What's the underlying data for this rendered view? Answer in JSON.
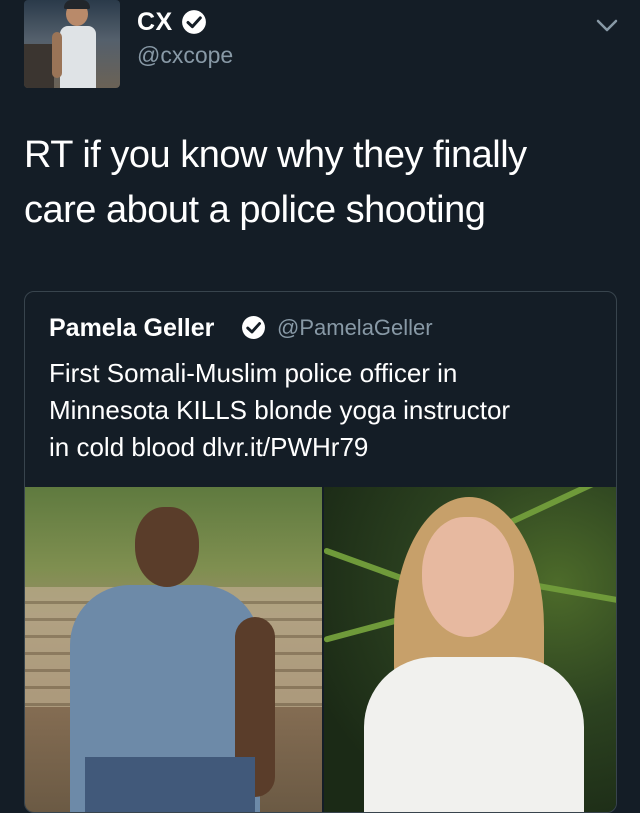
{
  "tweet": {
    "author": {
      "name": "CX",
      "handle": "@cxcope",
      "verified": true
    },
    "text": "RT if you know why they finally\ncare about a police shooting",
    "menu_icon": "chevron-down-icon"
  },
  "quoted_tweet": {
    "author": {
      "name": "Pamela Geller",
      "handle": "@PamelaGeller",
      "verified": true
    },
    "text": "First Somali-Muslim police officer in\nMinnesota KILLS blonde yoga instructor\nin cold blood dlvr.it/PWHr79"
  },
  "colors": {
    "background": "#141d26",
    "text": "#ffffff",
    "secondary_text": "#8899a6",
    "card_border": "#38444d",
    "verified_badge": "#ffffff"
  }
}
